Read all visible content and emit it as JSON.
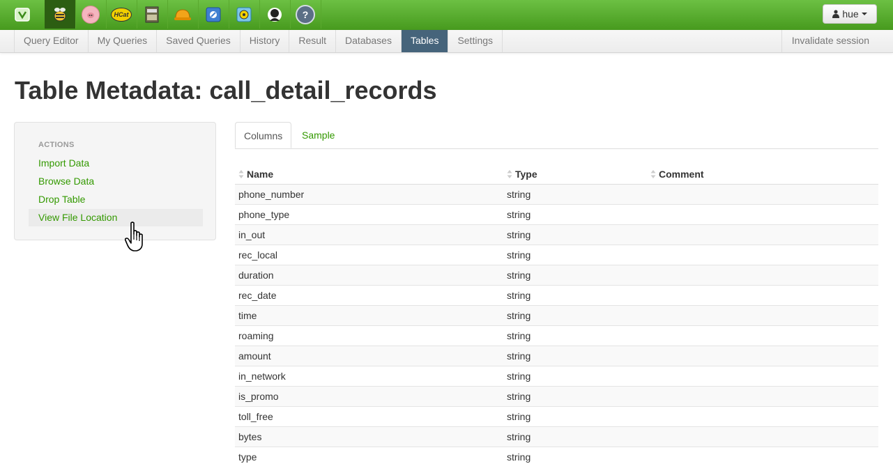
{
  "topbar": {
    "apps": [
      {
        "name": "hue-home-icon",
        "label": ""
      },
      {
        "name": "beeswax-icon",
        "label": ""
      },
      {
        "name": "pig-icon",
        "label": ""
      },
      {
        "name": "hcat-icon",
        "label": "HCat"
      },
      {
        "name": "file-browser-icon",
        "label": ""
      },
      {
        "name": "job-designer-icon",
        "label": ""
      },
      {
        "name": "oozie-icon",
        "label": ""
      },
      {
        "name": "job-browser-icon",
        "label": ""
      },
      {
        "name": "user-admin-icon",
        "label": ""
      },
      {
        "name": "help-icon",
        "label": "?"
      }
    ],
    "user": "hue"
  },
  "subnav": {
    "items": [
      "Query Editor",
      "My Queries",
      "Saved Queries",
      "History",
      "Result",
      "Databases",
      "Tables",
      "Settings"
    ],
    "active": "Tables",
    "invalidate": "Invalidate session"
  },
  "page": {
    "title": "Table Metadata: call_detail_records"
  },
  "sidebar": {
    "header": "ACTIONS",
    "links": [
      "Import Data",
      "Browse Data",
      "Drop Table",
      "View File Location"
    ]
  },
  "tabs": [
    "Columns",
    "Sample"
  ],
  "table": {
    "headers": [
      "Name",
      "Type",
      "Comment"
    ],
    "rows": [
      {
        "name": "phone_number",
        "type": "string",
        "comment": ""
      },
      {
        "name": "phone_type",
        "type": "string",
        "comment": ""
      },
      {
        "name": "in_out",
        "type": "string",
        "comment": ""
      },
      {
        "name": "rec_local",
        "type": "string",
        "comment": ""
      },
      {
        "name": "duration",
        "type": "string",
        "comment": ""
      },
      {
        "name": "rec_date",
        "type": "string",
        "comment": ""
      },
      {
        "name": "time",
        "type": "string",
        "comment": ""
      },
      {
        "name": "roaming",
        "type": "string",
        "comment": ""
      },
      {
        "name": "amount",
        "type": "string",
        "comment": ""
      },
      {
        "name": "in_network",
        "type": "string",
        "comment": ""
      },
      {
        "name": "is_promo",
        "type": "string",
        "comment": ""
      },
      {
        "name": "toll_free",
        "type": "string",
        "comment": ""
      },
      {
        "name": "bytes",
        "type": "string",
        "comment": ""
      },
      {
        "name": "type",
        "type": "string",
        "comment": ""
      }
    ]
  },
  "colors": {
    "accent_green": "#339900",
    "active_tab": "#46647b",
    "topbar": "#58ab2c"
  }
}
